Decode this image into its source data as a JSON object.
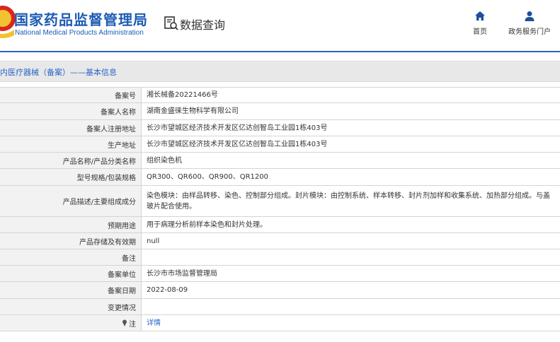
{
  "header": {
    "brand_cn": "国家药品监督管理局",
    "brand_en": "National Medical Products Administration",
    "search_title": "数据查询",
    "nav": [
      {
        "label": "首页",
        "icon": "home-icon"
      },
      {
        "label": "政务服务门户",
        "icon": "user-icon"
      }
    ],
    "accent": "#2a64c6",
    "brand_color": "#1d5bb4"
  },
  "breadcrumb": {
    "text": "内医疗器械（备案）——基本信息"
  },
  "details": {
    "rows": [
      {
        "label": "备案号",
        "value": "湘长械备20221466号"
      },
      {
        "label": "备案人名称",
        "value": "湖南金盛徕生物科学有限公司"
      },
      {
        "label": "备案人注册地址",
        "value": "长沙市望城区经济技术开发区亿达创智岛工业园1栋403号"
      },
      {
        "label": "生产地址",
        "value": "长沙市望城区经济技术开发区亿达创智岛工业园1栋403号"
      },
      {
        "label": "产品名称/产品分类名称",
        "value": "组织染色机"
      },
      {
        "label": "型号规格/包装规格",
        "value": "QR300、QR600、QR900、QR1200"
      },
      {
        "label": "产品描述/主要组成成分",
        "value": "染色模块：由样品转移、染色、控制部分组成。封片模块：由控制系统、样本转移、封片剂加样和收集系统、加热部分组成。与盖玻片配合使用。"
      },
      {
        "label": "预期用途",
        "value": "用于病理分析前样本染色和封片处理。"
      },
      {
        "label": "产品存储及有效期",
        "value": "null"
      },
      {
        "label": "备注",
        "value": ""
      },
      {
        "label": "备案单位",
        "value": "长沙市市场监督管理局"
      },
      {
        "label": "备案日期",
        "value": "2022-08-09"
      },
      {
        "label": "变更情况",
        "value": ""
      },
      {
        "label": "注",
        "value": "详情",
        "icon": "pin-icon"
      }
    ]
  }
}
